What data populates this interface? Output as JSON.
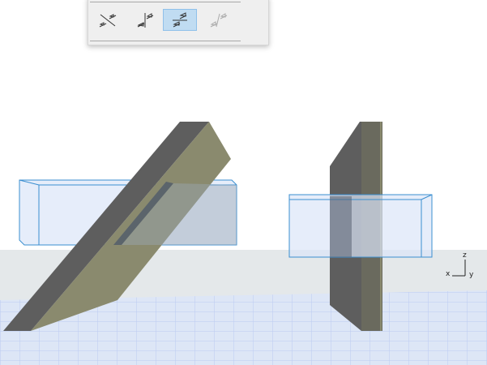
{
  "toolbar": {
    "buttons": [
      {
        "icon": "cross-intersection-icon",
        "selected": false,
        "enabled": true
      },
      {
        "icon": "side-connection-icon",
        "selected": false,
        "enabled": true
      },
      {
        "icon": "flat-connection-icon",
        "selected": true,
        "enabled": true
      },
      {
        "icon": "disabled-connection-icon",
        "selected": false,
        "enabled": false
      }
    ]
  },
  "axis_indicator": {
    "x": "x",
    "y": "y",
    "z": "z"
  },
  "colors": {
    "selected_bg": "#c0dcf2",
    "box_stroke": "#3b8fd0",
    "wall_dark": "#5e5e5e",
    "wall_side": "#8a8a6e"
  }
}
